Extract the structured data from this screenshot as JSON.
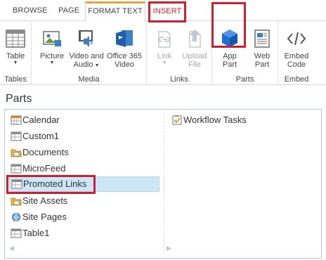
{
  "tabs": {
    "browse": "BROWSE",
    "page": "PAGE",
    "format_text": "FORMAT TEXT",
    "insert": "INSERT"
  },
  "ribbon": {
    "groups": {
      "tables": "Tables",
      "media": "Media",
      "links": "Links",
      "parts": "Parts",
      "embed": "Embed"
    },
    "buttons": {
      "table": "Table",
      "picture": "Picture",
      "video_audio_1": "Video and",
      "video_audio_2": "Audio",
      "office365_1": "Office 365",
      "office365_2": "Video",
      "link": "Link",
      "upload_1": "Upload",
      "upload_2": "File",
      "app_part_1": "App",
      "app_part_2": "Part",
      "web_part_1": "Web",
      "web_part_2": "Part",
      "embed_1": "Embed",
      "embed_2": "Code"
    }
  },
  "parts": {
    "title": "Parts",
    "left_items": [
      {
        "label": "Calendar",
        "icon": "calendar-icon"
      },
      {
        "label": "Custom1",
        "icon": "list-icon"
      },
      {
        "label": "Documents",
        "icon": "library-icon"
      },
      {
        "label": "MicroFeed",
        "icon": "list-icon"
      },
      {
        "label": "Promoted Links",
        "icon": "list-icon"
      },
      {
        "label": "Site Assets",
        "icon": "library-icon"
      },
      {
        "label": "Site Pages",
        "icon": "wiki-icon"
      },
      {
        "label": "Table1",
        "icon": "list-icon"
      }
    ],
    "right_items": [
      {
        "label": "Workflow Tasks",
        "icon": "tasks-icon"
      }
    ],
    "selected": "Promoted Links"
  },
  "colors": {
    "highlight_border": "#cc1f2f",
    "active_tab_accent": "#e8a33d",
    "selected_row": "#cde6f7",
    "app_part_blue": "#1f6fd1"
  }
}
